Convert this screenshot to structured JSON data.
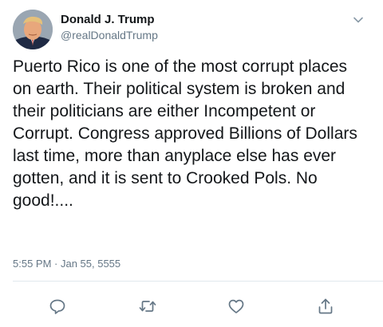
{
  "tweet": {
    "display_name": "Donald J. Trump",
    "handle": "@realDonaldTrump",
    "text": "Puerto Rico is one of the most corrupt places on earth. Their political system is broken and their politicians are either Incompetent or Corrupt. Congress approved Billions of Dollars last time, more than anyplace else has ever gotten, and it is sent to Crooked Pols. No good!....",
    "timestamp": "5:55 PM · Jan 55, 5555"
  },
  "icons": {
    "menu": "chevron-down-icon",
    "reply": "reply-icon",
    "retweet": "retweet-icon",
    "like": "heart-icon",
    "share": "share-icon"
  },
  "colors": {
    "text": "#14171a",
    "secondary": "#657786",
    "icon": "#657786",
    "divider": "#e1e8ed"
  }
}
